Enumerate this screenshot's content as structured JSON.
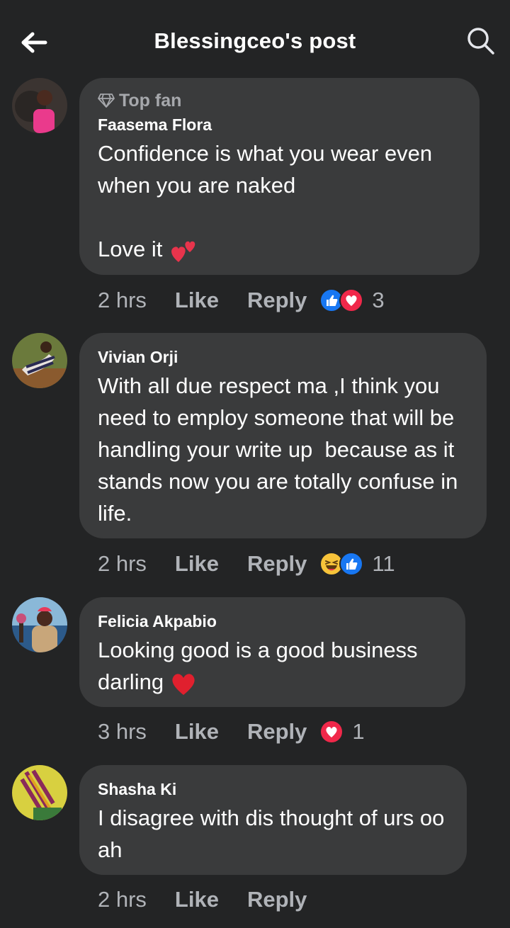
{
  "header": {
    "title": "Blessingceo's post",
    "back_icon": "back-arrow-icon",
    "search_icon": "search-icon"
  },
  "comments": [
    {
      "badge": "Top fan",
      "author": "Faasema Flora",
      "text": "Confidence is what you wear even when you are naked\n\nLove it",
      "emoji": "two-hearts",
      "time": "2 hrs",
      "like": "Like",
      "reply": "Reply",
      "reactions": [
        "like",
        "love"
      ],
      "reaction_count": "3"
    },
    {
      "author": "Vivian Orji",
      "text": "With all due respect ma ,I think you need to employ someone that will be handling your write up  because as it stands now you are totally confuse in life.",
      "time": "2 hrs",
      "like": "Like",
      "reply": "Reply",
      "reactions": [
        "haha",
        "like"
      ],
      "reaction_count": "11"
    },
    {
      "author": "Felicia Akpabio",
      "text": "Looking good is a good business darling",
      "emoji": "red-heart",
      "time": "3 hrs",
      "like": "Like",
      "reply": "Reply",
      "reactions": [
        "love"
      ],
      "reaction_count": "1"
    },
    {
      "author": "Shasha Ki",
      "text": "I disagree with dis thought of urs oo ah",
      "time": "2 hrs",
      "like": "Like",
      "reply": "Reply",
      "reactions": [],
      "reaction_count": ""
    }
  ],
  "colors": {
    "background": "#232425",
    "bubble": "#3a3b3c",
    "like_blue": "#1877f2",
    "love_red": "#f0284a",
    "haha_yellow": "#f7c33a"
  }
}
